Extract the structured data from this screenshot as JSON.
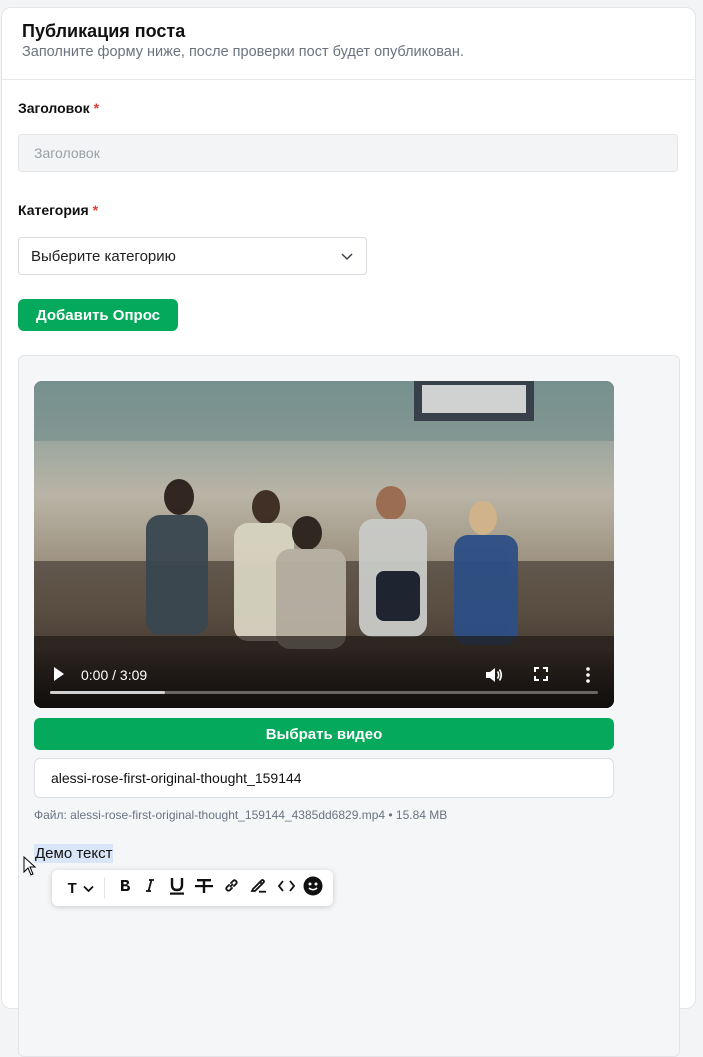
{
  "header": {
    "title": "Публикация поста",
    "subtitle": "Заполните форму ниже, после проверки пост будет опубликован."
  },
  "title_field": {
    "label": "Заголовок",
    "required_mark": "*",
    "placeholder": "Заголовок",
    "value": ""
  },
  "category_field": {
    "label": "Категория",
    "required_mark": "*",
    "selected": "Выберите категорию"
  },
  "add_poll_button": "Добавить Опрос",
  "video": {
    "time": "0:00 / 3:09",
    "progress_fraction": 0,
    "buffered_fraction": 0.21
  },
  "choose_video_button": "Выбрать видео",
  "filename_input": {
    "value": "alessi-rose-first-original-thought_159144"
  },
  "file_info": "Файл: alessi-rose-first-original-thought_159144_4385dd6829.mp4 • 15.84 MB",
  "editor": {
    "text": "Демо текст",
    "toolbar": {
      "text_type_label": "T"
    }
  },
  "colors": {
    "accent": "#04a95c",
    "required": "#e53935",
    "selection": "#d8e6f8"
  }
}
